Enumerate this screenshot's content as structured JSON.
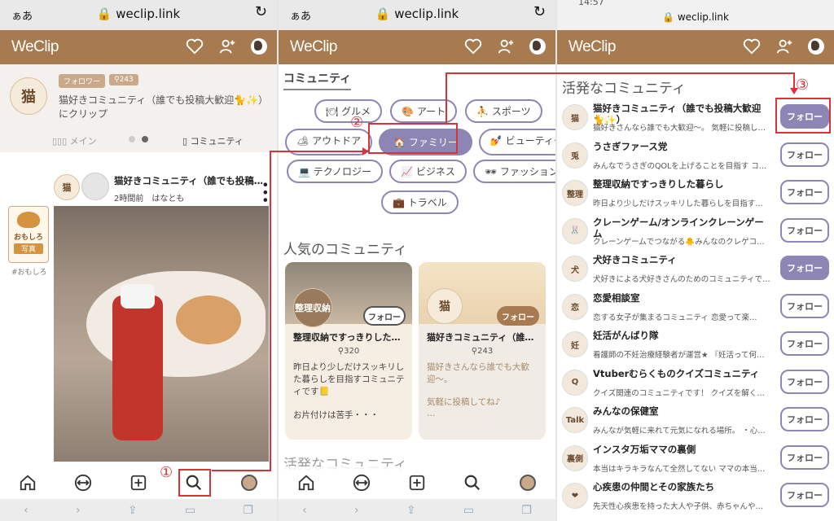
{
  "browser": {
    "aa": "ぁあ",
    "url": "weclip.link",
    "url_p3": "weclip.link",
    "clock_p3": "14:57"
  },
  "app": {
    "logo": "WeClip"
  },
  "panel1": {
    "tags": [
      "フォロワー",
      "243"
    ],
    "community_desc": "猫好きコミュニティ（誰でも投稿大歓迎🐈✨）にクリップ",
    "tab_main": "メイン",
    "tab_community": "コミュニティ",
    "post_community": "猫好きコミュニティ（誰でも投稿…",
    "post_meta": "2時間前　はなとも",
    "side_label": "#おもしろ",
    "side_sticker_top": "おもしろ",
    "side_sticker_bottom": "写真",
    "cat_badge": "猫",
    "marker": "①"
  },
  "panel2": {
    "section_community": "コミュニティ",
    "categories": [
      "グルメ",
      "アート",
      "スポーツ",
      "アウトドア",
      "ファミリー",
      "ビューティー",
      "テクノロジー",
      "ビジネス",
      "ファッション",
      "トラベル"
    ],
    "category_icons": [
      "🍽",
      "🎨",
      "⛹",
      "🏕",
      "🏠",
      "💅",
      "💻",
      "📈",
      "🕶",
      "💼"
    ],
    "popular_title": "人気のコミュニティ",
    "cards": [
      {
        "badge": "整理収納",
        "name": "整理収納ですっきりした…",
        "count": "320",
        "desc": "昨日より少しだけスッキリした暮らしを目指すコミュニティです📒",
        "desc2": "お片付けは苦手・・・",
        "follow": "フォロー"
      },
      {
        "badge": "猫",
        "name": "猫好きコミュニティ（誰…",
        "count": "243",
        "desc": "猫好きさんなら誰でも大歓迎〜。",
        "desc2": "気軽に投稿してね♪",
        "desc3": "…",
        "follow": "フォロー"
      }
    ],
    "active_title_partial": "活発なコミュニティ",
    "marker": "②"
  },
  "panel3": {
    "title": "活発なコミュニティ",
    "marker": "③",
    "rows": [
      {
        "avatar": "猫",
        "name": "猫好きコミュニティ（誰でも投稿大歓迎🐈✨）",
        "desc": "猫好きさんなら誰でも大歓迎〜。 気軽に投稿し…",
        "follow": "フォロー",
        "on": true
      },
      {
        "avatar": "兎",
        "name": "うさぎファース党",
        "desc": "みんなでうさぎのQOLを上げることを目指す コ…",
        "follow": "フォロー",
        "on": false
      },
      {
        "avatar": "整理",
        "name": "整理収納ですっきりした暮らし",
        "desc": "昨日より少しだけスッキリした暮らしを目指す…",
        "follow": "フォロー",
        "on": false
      },
      {
        "avatar": "🐰",
        "name": "クレーンゲーム/オンラインクレーンゲーム",
        "desc": "クレーンゲームでつながる🐥みんなのクレゲコ…",
        "follow": "フォロー",
        "on": false
      },
      {
        "avatar": "犬",
        "name": "犬好きコミュニティ",
        "desc": "犬好きによる犬好きさんのためのコミュニティで…",
        "follow": "フォロー",
        "on": true
      },
      {
        "avatar": "恋",
        "name": "恋愛相談室",
        "desc": "恋する女子が集まるコミュニティ 恋愛って楽…",
        "follow": "フォロー",
        "on": false
      },
      {
        "avatar": "妊",
        "name": "妊活がんばり隊",
        "desc": "看護師の不妊治療経験者が運営★ 『妊活って何…",
        "follow": "フォロー",
        "on": false
      },
      {
        "avatar": "Q",
        "name": "Vtuberむらくものクイズコミュニティ",
        "desc": "クイズ関連のコミュニティです！ クイズを解く…",
        "follow": "フォロー",
        "on": false
      },
      {
        "avatar": "Talk",
        "name": "みんなの保健室",
        "desc": "みんなが気軽に来れて元気になれる場所。 ・心…",
        "follow": "フォロー",
        "on": false
      },
      {
        "avatar": "裏側",
        "name": "インスタ万垢ママの裏側",
        "desc": "本当はキラキラなんて全然してない ママの本当…",
        "follow": "フォロー",
        "on": false
      },
      {
        "avatar": "❤",
        "name": "心疾患の仲間とその家族たち",
        "desc": "先天性心疾患を持った大人や子供、赤ちゃんや…",
        "follow": "フォロー",
        "on": false
      }
    ]
  }
}
